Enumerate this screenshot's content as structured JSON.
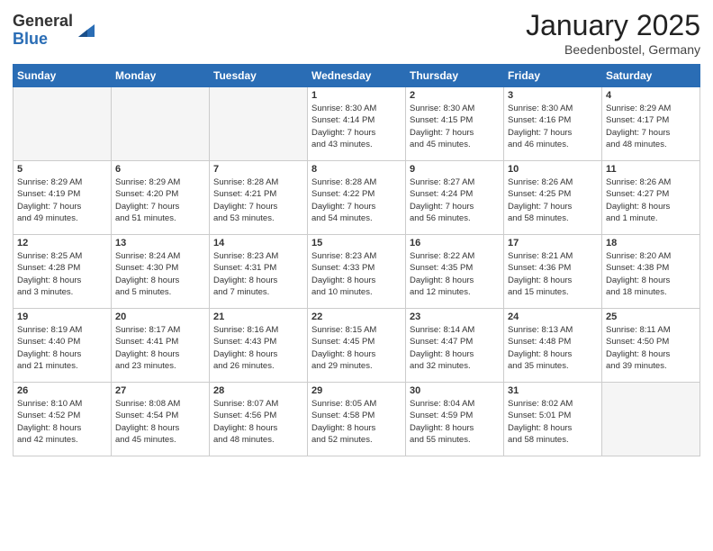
{
  "header": {
    "logo_general": "General",
    "logo_blue": "Blue",
    "month_title": "January 2025",
    "location": "Beedenbostel, Germany"
  },
  "weekdays": [
    "Sunday",
    "Monday",
    "Tuesday",
    "Wednesday",
    "Thursday",
    "Friday",
    "Saturday"
  ],
  "weeks": [
    [
      {
        "day": "",
        "info": ""
      },
      {
        "day": "",
        "info": ""
      },
      {
        "day": "",
        "info": ""
      },
      {
        "day": "1",
        "info": "Sunrise: 8:30 AM\nSunset: 4:14 PM\nDaylight: 7 hours\nand 43 minutes."
      },
      {
        "day": "2",
        "info": "Sunrise: 8:30 AM\nSunset: 4:15 PM\nDaylight: 7 hours\nand 45 minutes."
      },
      {
        "day": "3",
        "info": "Sunrise: 8:30 AM\nSunset: 4:16 PM\nDaylight: 7 hours\nand 46 minutes."
      },
      {
        "day": "4",
        "info": "Sunrise: 8:29 AM\nSunset: 4:17 PM\nDaylight: 7 hours\nand 48 minutes."
      }
    ],
    [
      {
        "day": "5",
        "info": "Sunrise: 8:29 AM\nSunset: 4:19 PM\nDaylight: 7 hours\nand 49 minutes."
      },
      {
        "day": "6",
        "info": "Sunrise: 8:29 AM\nSunset: 4:20 PM\nDaylight: 7 hours\nand 51 minutes."
      },
      {
        "day": "7",
        "info": "Sunrise: 8:28 AM\nSunset: 4:21 PM\nDaylight: 7 hours\nand 53 minutes."
      },
      {
        "day": "8",
        "info": "Sunrise: 8:28 AM\nSunset: 4:22 PM\nDaylight: 7 hours\nand 54 minutes."
      },
      {
        "day": "9",
        "info": "Sunrise: 8:27 AM\nSunset: 4:24 PM\nDaylight: 7 hours\nand 56 minutes."
      },
      {
        "day": "10",
        "info": "Sunrise: 8:26 AM\nSunset: 4:25 PM\nDaylight: 7 hours\nand 58 minutes."
      },
      {
        "day": "11",
        "info": "Sunrise: 8:26 AM\nSunset: 4:27 PM\nDaylight: 8 hours\nand 1 minute."
      }
    ],
    [
      {
        "day": "12",
        "info": "Sunrise: 8:25 AM\nSunset: 4:28 PM\nDaylight: 8 hours\nand 3 minutes."
      },
      {
        "day": "13",
        "info": "Sunrise: 8:24 AM\nSunset: 4:30 PM\nDaylight: 8 hours\nand 5 minutes."
      },
      {
        "day": "14",
        "info": "Sunrise: 8:23 AM\nSunset: 4:31 PM\nDaylight: 8 hours\nand 7 minutes."
      },
      {
        "day": "15",
        "info": "Sunrise: 8:23 AM\nSunset: 4:33 PM\nDaylight: 8 hours\nand 10 minutes."
      },
      {
        "day": "16",
        "info": "Sunrise: 8:22 AM\nSunset: 4:35 PM\nDaylight: 8 hours\nand 12 minutes."
      },
      {
        "day": "17",
        "info": "Sunrise: 8:21 AM\nSunset: 4:36 PM\nDaylight: 8 hours\nand 15 minutes."
      },
      {
        "day": "18",
        "info": "Sunrise: 8:20 AM\nSunset: 4:38 PM\nDaylight: 8 hours\nand 18 minutes."
      }
    ],
    [
      {
        "day": "19",
        "info": "Sunrise: 8:19 AM\nSunset: 4:40 PM\nDaylight: 8 hours\nand 21 minutes."
      },
      {
        "day": "20",
        "info": "Sunrise: 8:17 AM\nSunset: 4:41 PM\nDaylight: 8 hours\nand 23 minutes."
      },
      {
        "day": "21",
        "info": "Sunrise: 8:16 AM\nSunset: 4:43 PM\nDaylight: 8 hours\nand 26 minutes."
      },
      {
        "day": "22",
        "info": "Sunrise: 8:15 AM\nSunset: 4:45 PM\nDaylight: 8 hours\nand 29 minutes."
      },
      {
        "day": "23",
        "info": "Sunrise: 8:14 AM\nSunset: 4:47 PM\nDaylight: 8 hours\nand 32 minutes."
      },
      {
        "day": "24",
        "info": "Sunrise: 8:13 AM\nSunset: 4:48 PM\nDaylight: 8 hours\nand 35 minutes."
      },
      {
        "day": "25",
        "info": "Sunrise: 8:11 AM\nSunset: 4:50 PM\nDaylight: 8 hours\nand 39 minutes."
      }
    ],
    [
      {
        "day": "26",
        "info": "Sunrise: 8:10 AM\nSunset: 4:52 PM\nDaylight: 8 hours\nand 42 minutes."
      },
      {
        "day": "27",
        "info": "Sunrise: 8:08 AM\nSunset: 4:54 PM\nDaylight: 8 hours\nand 45 minutes."
      },
      {
        "day": "28",
        "info": "Sunrise: 8:07 AM\nSunset: 4:56 PM\nDaylight: 8 hours\nand 48 minutes."
      },
      {
        "day": "29",
        "info": "Sunrise: 8:05 AM\nSunset: 4:58 PM\nDaylight: 8 hours\nand 52 minutes."
      },
      {
        "day": "30",
        "info": "Sunrise: 8:04 AM\nSunset: 4:59 PM\nDaylight: 8 hours\nand 55 minutes."
      },
      {
        "day": "31",
        "info": "Sunrise: 8:02 AM\nSunset: 5:01 PM\nDaylight: 8 hours\nand 58 minutes."
      },
      {
        "day": "",
        "info": ""
      }
    ]
  ]
}
